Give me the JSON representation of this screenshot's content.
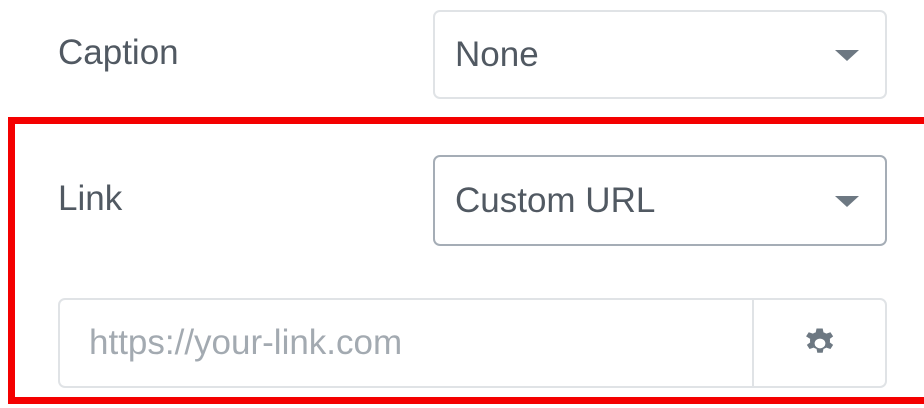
{
  "caption": {
    "label": "Caption",
    "selected": "None"
  },
  "link": {
    "label": "Link",
    "selected": "Custom URL",
    "url_placeholder": "https://your-link.com",
    "url_value": "",
    "settings_icon": "gear-icon"
  },
  "colors": {
    "highlight": "#f40000",
    "text": "#515962",
    "placeholder": "#a3aab1",
    "border": "#e0e3e6",
    "border_focus": "#a5adb6",
    "icon": "#6d7882"
  }
}
